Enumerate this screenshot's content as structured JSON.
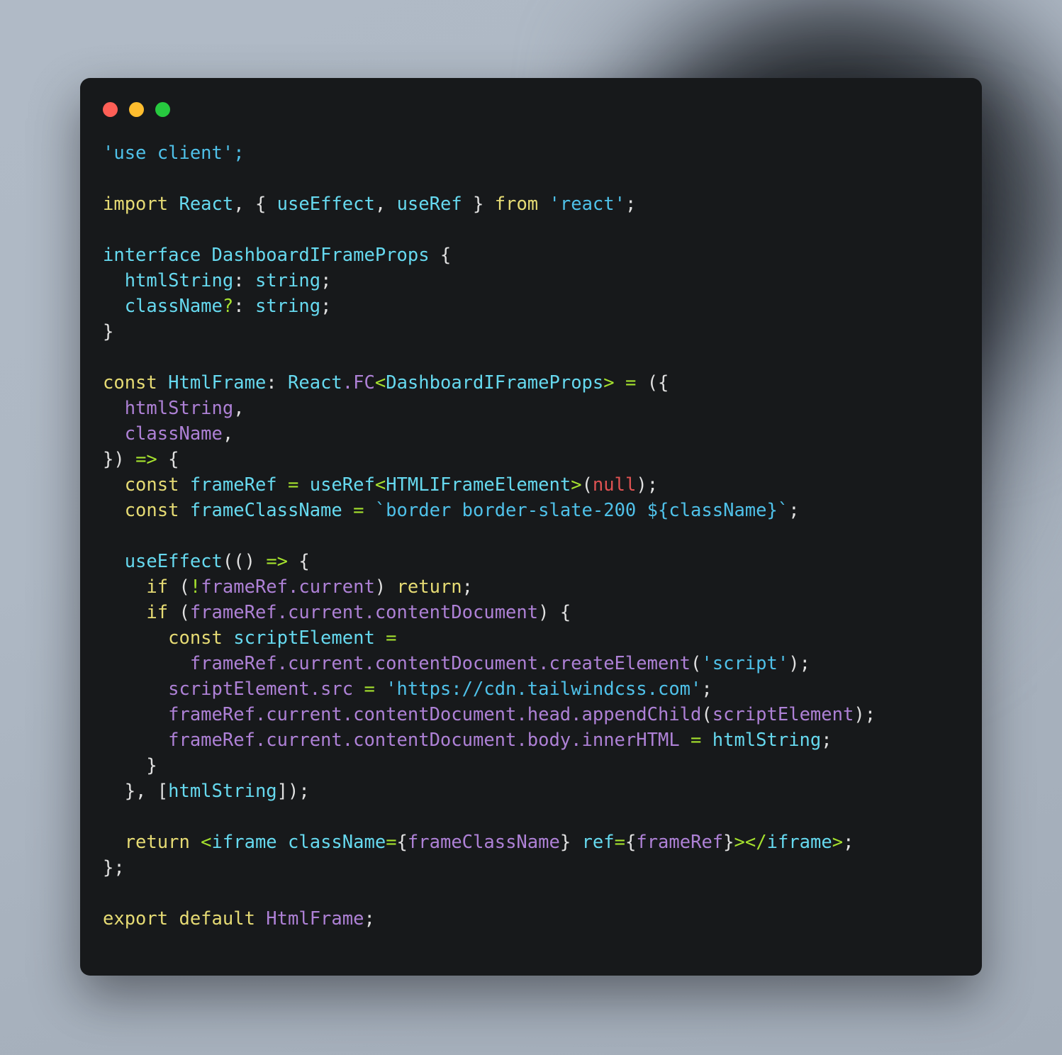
{
  "window": {
    "traffic_lights": [
      {
        "name": "close",
        "color": "#ff5f56",
        "label": "Close"
      },
      {
        "name": "minimize",
        "color": "#ffbd2e",
        "label": "Minimize"
      },
      {
        "name": "maximize",
        "color": "#27c93f",
        "label": "Maximize"
      }
    ],
    "background_color": "#17191b",
    "page_background": "#aeb8c4"
  },
  "code": {
    "language": "tsx",
    "filename_component": "HtmlFrame",
    "lines": [
      "'use client';",
      "",
      "import React, { useEffect, useRef } from 'react';",
      "",
      "interface DashboardIFrameProps {",
      "  htmlString: string;",
      "  className?: string;",
      "}",
      "",
      "const HtmlFrame: React.FC<DashboardIFrameProps> = ({",
      "  htmlString,",
      "  className,",
      "}) => {",
      "  const frameRef = useRef<HTMLIFrameElement>(null);",
      "  const frameClassName = `border border-slate-200 ${className}`;",
      "",
      "  useEffect(() => {",
      "    if (!frameRef.current) return;",
      "    if (frameRef.current.contentDocument) {",
      "      const scriptElement =",
      "        frameRef.current.contentDocument.createElement('script');",
      "      scriptElement.src = 'https://cdn.tailwindcss.com';",
      "      frameRef.current.contentDocument.head.appendChild(scriptElement);",
      "      frameRef.current.contentDocument.body.innerHTML = htmlString;",
      "    }",
      "  }, [htmlString]);",
      "",
      "  return <iframe className={frameClassName} ref={frameRef}></iframe>;",
      "};",
      "",
      "export default HtmlFrame;"
    ],
    "tokens": [
      [
        [
          "'use client';",
          "t-str"
        ]
      ],
      [],
      [
        [
          "import ",
          "t-key"
        ],
        [
          "React",
          "t-fn"
        ],
        [
          ", ",
          "t-punc"
        ],
        [
          "{ ",
          "t-punc"
        ],
        [
          "useEffect",
          "t-fn"
        ],
        [
          ", ",
          "t-punc"
        ],
        [
          "useRef",
          "t-fn"
        ],
        [
          " } ",
          "t-punc"
        ],
        [
          "from ",
          "t-key"
        ],
        [
          "'react'",
          "t-str"
        ],
        [
          ";",
          "t-punc"
        ]
      ],
      [],
      [
        [
          "interface ",
          "t-fn"
        ],
        [
          "DashboardIFrameProps",
          "t-fn"
        ],
        [
          " {",
          "t-punc"
        ]
      ],
      [
        [
          "  htmlString",
          "t-fn"
        ],
        [
          ": ",
          "t-punc"
        ],
        [
          "string",
          "t-fn"
        ],
        [
          ";",
          "t-punc"
        ]
      ],
      [
        [
          "  className",
          "t-fn"
        ],
        [
          "?",
          "t-op"
        ],
        [
          ": ",
          "t-punc"
        ],
        [
          "string",
          "t-fn"
        ],
        [
          ";",
          "t-punc"
        ]
      ],
      [
        [
          "}",
          "t-punc"
        ]
      ],
      [],
      [
        [
          "const ",
          "t-key"
        ],
        [
          "HtmlFrame",
          "t-fn"
        ],
        [
          ": ",
          "t-punc"
        ],
        [
          "React",
          "t-fn"
        ],
        [
          ".",
          "t-ident"
        ],
        [
          "FC",
          "t-ident"
        ],
        [
          "<",
          "t-op"
        ],
        [
          "DashboardIFrameProps",
          "t-fn"
        ],
        [
          ">",
          "t-op"
        ],
        [
          " = ",
          "t-op"
        ],
        [
          "({",
          "t-punc"
        ]
      ],
      [
        [
          "  htmlString",
          "t-ident"
        ],
        [
          ",",
          "t-punc"
        ]
      ],
      [
        [
          "  className",
          "t-ident"
        ],
        [
          ",",
          "t-punc"
        ]
      ],
      [
        [
          "}) ",
          "t-punc"
        ],
        [
          "=>",
          "t-op"
        ],
        [
          " {",
          "t-punc"
        ]
      ],
      [
        [
          "  const ",
          "t-key"
        ],
        [
          "frameRef",
          "t-fn"
        ],
        [
          " = ",
          "t-op"
        ],
        [
          "useRef",
          "t-fn"
        ],
        [
          "<",
          "t-op"
        ],
        [
          "HTMLIFrameElement",
          "t-fn"
        ],
        [
          ">",
          "t-op"
        ],
        [
          "(",
          "t-punc"
        ],
        [
          "null",
          "t-num"
        ],
        [
          ");",
          "t-punc"
        ]
      ],
      [
        [
          "  const ",
          "t-key"
        ],
        [
          "frameClassName",
          "t-fn"
        ],
        [
          " = ",
          "t-op"
        ],
        [
          "`border border-slate-200 ${className}`",
          "t-str"
        ],
        [
          ";",
          "t-punc"
        ]
      ],
      [],
      [
        [
          "  useEffect",
          "t-fn"
        ],
        [
          "(() ",
          "t-punc"
        ],
        [
          "=>",
          "t-op"
        ],
        [
          " {",
          "t-punc"
        ]
      ],
      [
        [
          "    if ",
          "t-key"
        ],
        [
          "(",
          "t-punc"
        ],
        [
          "!",
          "t-op"
        ],
        [
          "frameRef.current",
          "t-ident"
        ],
        [
          ") ",
          "t-punc"
        ],
        [
          "return",
          "t-key"
        ],
        [
          ";",
          "t-punc"
        ]
      ],
      [
        [
          "    if ",
          "t-key"
        ],
        [
          "(",
          "t-punc"
        ],
        [
          "frameRef.current.contentDocument",
          "t-ident"
        ],
        [
          ") {",
          "t-punc"
        ]
      ],
      [
        [
          "      const ",
          "t-key"
        ],
        [
          "scriptElement",
          "t-fn"
        ],
        [
          " =",
          "t-op"
        ]
      ],
      [
        [
          "        frameRef.current.contentDocument.createElement",
          "t-ident"
        ],
        [
          "(",
          "t-punc"
        ],
        [
          "'script'",
          "t-str"
        ],
        [
          ");",
          "t-punc"
        ]
      ],
      [
        [
          "      scriptElement.src",
          "t-ident"
        ],
        [
          " = ",
          "t-op"
        ],
        [
          "'https://cdn.tailwindcss.com'",
          "t-str"
        ],
        [
          ";",
          "t-punc"
        ]
      ],
      [
        [
          "      frameRef.current.contentDocument.head.appendChild",
          "t-ident"
        ],
        [
          "(",
          "t-punc"
        ],
        [
          "scriptElement",
          "t-ident"
        ],
        [
          ");",
          "t-punc"
        ]
      ],
      [
        [
          "      frameRef.current.contentDocument.body.innerHTML",
          "t-ident"
        ],
        [
          " = ",
          "t-op"
        ],
        [
          "htmlString",
          "t-fn"
        ],
        [
          ";",
          "t-punc"
        ]
      ],
      [
        [
          "    }",
          "t-punc"
        ]
      ],
      [
        [
          "  }, [",
          "t-punc"
        ],
        [
          "htmlString",
          "t-fn"
        ],
        [
          "]);",
          "t-punc"
        ]
      ],
      [],
      [
        [
          "  return ",
          "t-key"
        ],
        [
          "<",
          "t-op"
        ],
        [
          "iframe",
          "t-fn"
        ],
        [
          " ",
          "t-punc"
        ],
        [
          "className",
          "t-fn"
        ],
        [
          "=",
          "t-op"
        ],
        [
          "{",
          "t-punc"
        ],
        [
          "frameClassName",
          "t-ident"
        ],
        [
          "} ",
          "t-punc"
        ],
        [
          "ref",
          "t-fn"
        ],
        [
          "=",
          "t-op"
        ],
        [
          "{",
          "t-punc"
        ],
        [
          "frameRef",
          "t-ident"
        ],
        [
          "}",
          "t-punc"
        ],
        [
          ">",
          "t-op"
        ],
        [
          "</",
          "t-op"
        ],
        [
          "iframe",
          "t-fn"
        ],
        [
          ">",
          "t-op"
        ],
        [
          ";",
          "t-punc"
        ]
      ],
      [
        [
          "};",
          "t-punc"
        ]
      ],
      [],
      [
        [
          "export default ",
          "t-key"
        ],
        [
          "HtmlFrame",
          "t-ident"
        ],
        [
          ";",
          "t-punc"
        ]
      ]
    ],
    "palette": {
      "keyword": "#e6db74",
      "function": "#66d9ef",
      "string": "#4fc1e9",
      "identifier": "#ae81d6",
      "operator": "#a6e22e",
      "constant": "#e05252",
      "punctuation": "#e0e0e0",
      "background": "#17191b"
    }
  }
}
